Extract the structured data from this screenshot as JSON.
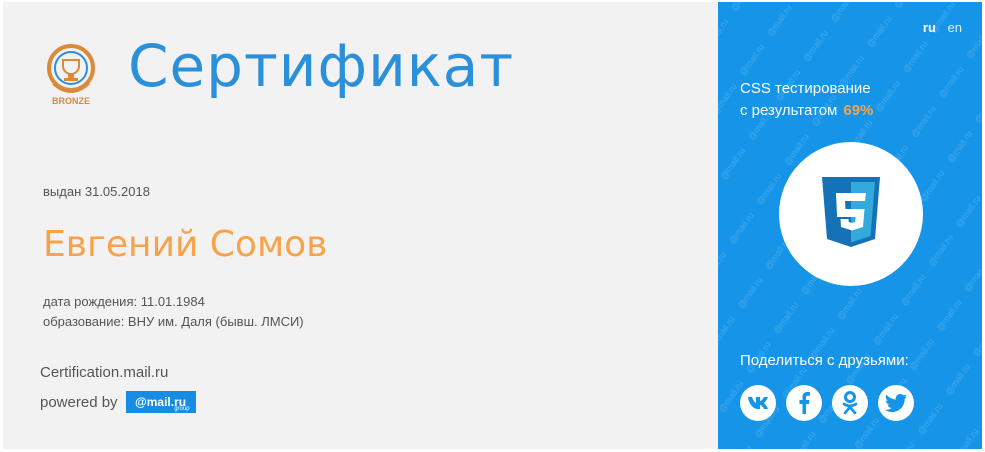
{
  "certificate": {
    "badge_label": "BRONZE",
    "title": "Сертификат",
    "issued": "выдан 31.05.2018",
    "name": "Евгений Сомов",
    "birth": "дата рождения: 11.01.1984",
    "education": "образование: ВНУ им. Даля (бывш. ЛМСИ)",
    "site": "Certification.mail.ru",
    "powered_by": "powered by",
    "powered_logo": "@mail.ru",
    "powered_logo_sub": "group"
  },
  "panel": {
    "languages": [
      {
        "label": "ru",
        "active": true
      },
      {
        "label": "en",
        "active": false
      }
    ],
    "test_line1": "CSS тестирование",
    "test_line2": "с результатом",
    "score": "69%",
    "share_label": "Поделиться с друзьями:",
    "socials": [
      "vk-icon",
      "facebook-icon",
      "odnoklassniki-icon",
      "twitter-icon"
    ]
  },
  "colors": {
    "title": "#2b8fd9",
    "name": "#f7a34a",
    "panel": "#1695e8",
    "score": "#f7a34a"
  }
}
